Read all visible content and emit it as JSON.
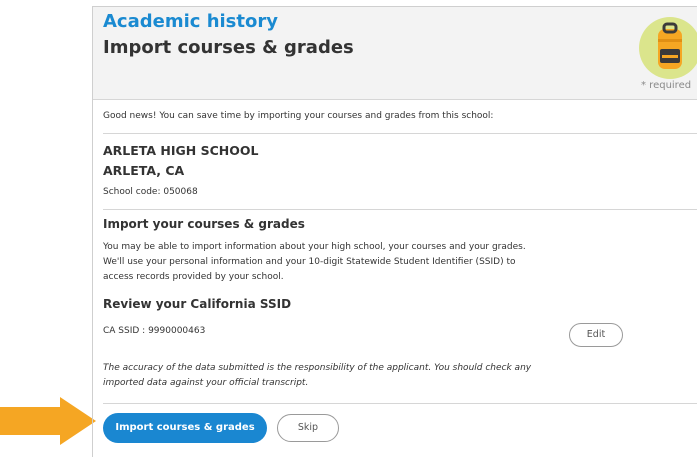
{
  "header": {
    "app_title": "Academic history",
    "page_title": "Import courses & grades",
    "required_note": "* required",
    "illustration_icon": "backpack-icon"
  },
  "intro": {
    "text": "Good news! You can save time by importing your courses and grades from this school:"
  },
  "school": {
    "name": "ARLETA HIGH SCHOOL",
    "location": "ARLETA, CA",
    "code_text": "School code: 050068"
  },
  "import_section": {
    "title": "Import your courses & grades",
    "lines": [
      "You may be able to import information about your high school, your courses and your grades.",
      "We'll use your personal information and your 10-digit Statewide Student Identifier (SSID) to",
      "access records provided by your school."
    ]
  },
  "ssid_section": {
    "title": "Review your California SSID",
    "value_text": "CA SSID : 9990000463",
    "edit_label": "Edit",
    "disclaimer_lines": [
      "The accuracy of the data submitted is the responsibility of the applicant. You should check any",
      "imported data against your official transcript."
    ]
  },
  "actions": {
    "import_label": "Import courses & grades",
    "skip_label": "Skip"
  },
  "colors": {
    "accent": "#1a87d1",
    "pointer_arrow": "#f5a623",
    "header_bg": "#f3f3f3"
  }
}
